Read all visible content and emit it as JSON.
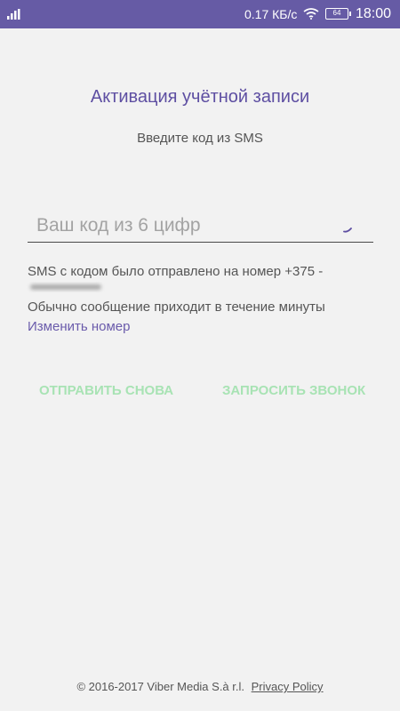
{
  "status_bar": {
    "network_speed": "0.17 КБ/с",
    "battery_level": "64",
    "time": "18:00",
    "icons": [
      "signal-icon",
      "wifi-icon",
      "battery-icon"
    ],
    "background_color": "#665ba5"
  },
  "activation": {
    "title": "Активация учётной записи",
    "subtitle": "Введите код из SMS",
    "code_input": {
      "placeholder": "Ваш код из 6 цифр",
      "value": ""
    },
    "sms_sent_text": "SMS с кодом было отправлено на номер +375 -",
    "usual_time_text": "Обычно сообщение приходит в течение минуты",
    "change_number_link": "Изменить номер",
    "resend_button": "ОТПРАВИТЬ СНОВА",
    "request_call_button": "ЗАПРОСИТЬ ЗВОНОК"
  },
  "footer": {
    "copyright": "© 2016-2017 Viber Media S.à r.l.",
    "privacy_policy_link": "Privacy Policy"
  },
  "colors": {
    "accent": "#5e4fa2",
    "link": "#6a5bab",
    "disabled_action": "#a8e3b4",
    "background": "#f2f2f2"
  }
}
